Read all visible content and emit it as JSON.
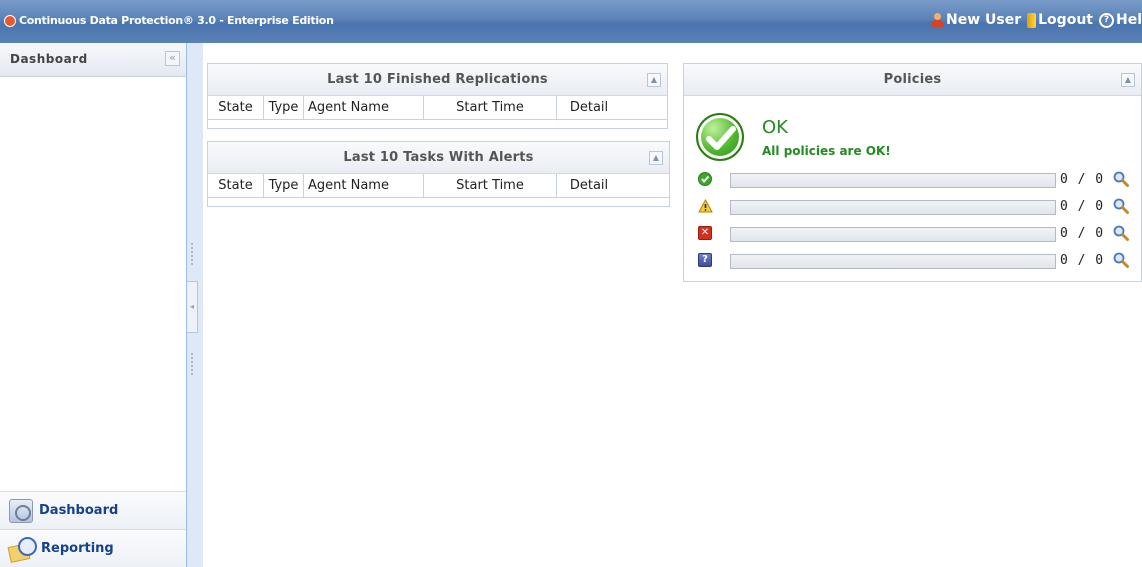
{
  "app": {
    "title": "Continuous Data Protection® 3.0 - Enterprise Edition",
    "actions": {
      "new_user": "New User",
      "logout": "Logout",
      "help": "Hel"
    }
  },
  "sidebar": {
    "title": "Dashboard",
    "collapse_glyph": "«",
    "nav": [
      {
        "label": "Dashboard",
        "icon": "dashboard-icon"
      },
      {
        "label": "Reporting",
        "icon": "reporting-icon"
      }
    ]
  },
  "panels": {
    "replications": {
      "title": "Last 10 Finished Replications",
      "columns": [
        "State",
        "Type",
        "Agent Name",
        "Start Time",
        "Detail"
      ]
    },
    "alerts": {
      "title": "Last 10 Tasks With Alerts",
      "columns": [
        "State",
        "Type",
        "Agent Name",
        "Start Time",
        "Detail"
      ]
    },
    "policies": {
      "title": "Policies",
      "status": "OK",
      "message": "All policies are OK!",
      "rows": [
        {
          "icon": "ok-icon",
          "count": "0 / 0",
          "progress": 0
        },
        {
          "icon": "warning-icon",
          "count": "0 / 0",
          "progress": 0
        },
        {
          "icon": "error-icon",
          "count": "0 / 0",
          "progress": 0
        },
        {
          "icon": "unknown-icon",
          "count": "0 / 0",
          "progress": 0
        }
      ]
    }
  },
  "colors": {
    "ok_green": "#228b22",
    "header_blue": "#5a82b8",
    "nav_text": "#15428b"
  }
}
